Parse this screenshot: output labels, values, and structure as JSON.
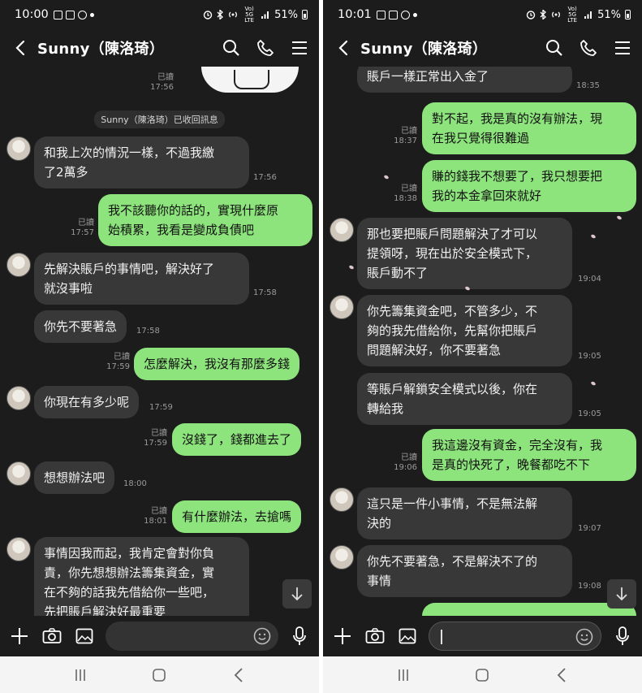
{
  "left": {
    "status": {
      "time": "10:00",
      "signal_text": "Vo) 5G LTE",
      "battery": "51%"
    },
    "header": {
      "title": "Sunny（陳洛琦）"
    },
    "system_note": "Sunny（陳洛琦）已收回訊息",
    "sticker_meta": {
      "read": "已讀",
      "time": "17:56"
    },
    "messages": [
      {
        "dir": "in",
        "text": "和我上次的情況一樣，不過我繳\n了2萬多",
        "time": "17:56"
      },
      {
        "dir": "out",
        "text": "我不該聽你的話的，實現什麼原\n始積累，我看是變成負債吧",
        "read": "已讀",
        "time": "17:57"
      },
      {
        "dir": "in",
        "text": "先解決賬戶的事情吧，解決好了\n就沒事啦",
        "time": "17:58"
      },
      {
        "dir": "in",
        "text": "你先不要著急",
        "time": "17:58"
      },
      {
        "dir": "out",
        "text": "怎麼解決，我沒有那麼多錢",
        "read": "已讀",
        "time": "17:59"
      },
      {
        "dir": "in",
        "text": "你現在有多少呢",
        "time": "17:59"
      },
      {
        "dir": "out",
        "text": "沒錢了，錢都進去了",
        "read": "已讀",
        "time": "17:59"
      },
      {
        "dir": "in",
        "text": "想想辦法吧",
        "time": "18:00"
      },
      {
        "dir": "out",
        "text": "有什麼辦法，去搶嗎",
        "read": "已讀",
        "time": "18:01"
      },
      {
        "dir": "in",
        "text": "事情因我而起，我肯定會對你負\n責，你先想想辦法籌集資金，實\n在不夠的話我先借給你一些吧，\n先把賬戶解決好最重要",
        "time": ""
      }
    ]
  },
  "right": {
    "status": {
      "time": "10:01",
      "signal_text": "Vo) 5G LTE",
      "battery": "51%"
    },
    "header": {
      "title": "Sunny（陳洛琦）"
    },
    "messages": [
      {
        "dir": "in",
        "text": "賬戶一樣正常出入金了",
        "time": "18:35"
      },
      {
        "dir": "out",
        "text": "對不起，我是真的沒有辦法，現\n在我只覺得很難過",
        "read": "已讀",
        "time": "18:37"
      },
      {
        "dir": "out",
        "text": "賺的錢我不想要了，我只想要把\n我的本金拿回來就好",
        "read": "已讀",
        "time": "18:38"
      },
      {
        "dir": "in",
        "text": "那也要把賬戶問題解決了才可以\n提領呀，現在出於安全模式下，\n賬戶動不了",
        "time": "19:04"
      },
      {
        "dir": "in",
        "text": "你先籌集資金吧，不管多少，不\n夠的我先借給你，先幫你把賬戶\n問題解決好，你不要著急",
        "time": "19:05"
      },
      {
        "dir": "in",
        "text": "等賬戶解鎖安全模式以後，你在\n轉給我",
        "time": "19:05"
      },
      {
        "dir": "out",
        "text": "我這邊沒有資金，完全沒有，我\n是真的快死了，晚餐都吃不下",
        "read": "已讀",
        "time": "19:06"
      },
      {
        "dir": "in",
        "text": "這只是一件小事情，不是無法解\n決的",
        "time": "19:07"
      },
      {
        "dir": "in",
        "text": "你先不要著急，不是解決不了的\n事情",
        "time": "19:08"
      }
    ]
  }
}
